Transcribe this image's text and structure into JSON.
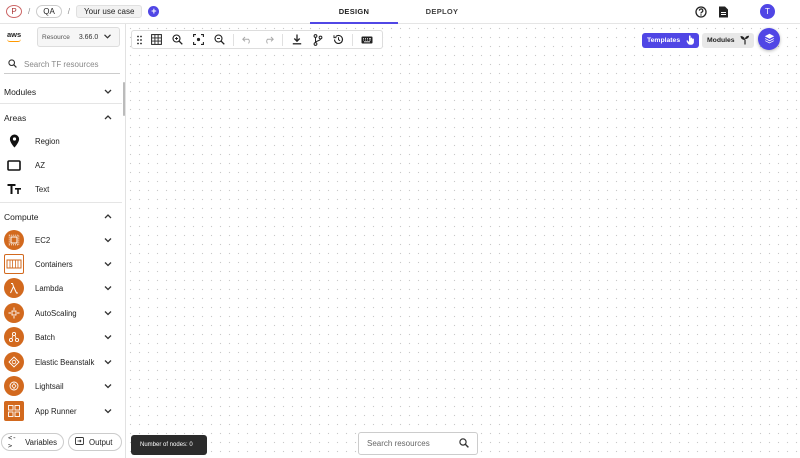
{
  "breadcrumb": {
    "project_initial": "P",
    "env": "QA",
    "use_case": "Your use case",
    "separator": "/"
  },
  "tabs": [
    {
      "label": "DESIGN",
      "active": true
    },
    {
      "label": "DEPLOY",
      "active": false
    }
  ],
  "user": {
    "initial": "T"
  },
  "sidebar": {
    "provider_logo": "aws",
    "resource_label": "Resource",
    "resource_version": "3.66.0",
    "search_placeholder": "Search TF resources",
    "sections": {
      "modules": "Modules",
      "areas": "Areas",
      "compute": "Compute"
    },
    "areas_items": [
      {
        "label": "Region",
        "icon": "map-pin-icon"
      },
      {
        "label": "AZ",
        "icon": "rectangle-icon"
      },
      {
        "label": "Text",
        "icon": "text-icon"
      }
    ],
    "compute_items": [
      {
        "label": "EC2",
        "icon": "ec2-icon"
      },
      {
        "label": "Containers",
        "icon": "containers-icon"
      },
      {
        "label": "Lambda",
        "icon": "lambda-icon"
      },
      {
        "label": "AutoScaling",
        "icon": "autoscaling-icon"
      },
      {
        "label": "Batch",
        "icon": "batch-icon"
      },
      {
        "label": "Elastic Beanstalk",
        "icon": "elastic-beanstalk-icon"
      },
      {
        "label": "Lightsail",
        "icon": "lightsail-icon"
      },
      {
        "label": "App Runner",
        "icon": "app-runner-icon"
      }
    ],
    "variables_label": "Variables",
    "output_label": "Output"
  },
  "canvas": {
    "templates_label": "Templates",
    "modules_label": "Modules",
    "nodes_text": "Number of nodes: 0",
    "search_placeholder": "Search resources"
  },
  "colors": {
    "accent": "#5046e5",
    "aws_service": "#d2691e",
    "aws_orange": "#ff9900"
  }
}
